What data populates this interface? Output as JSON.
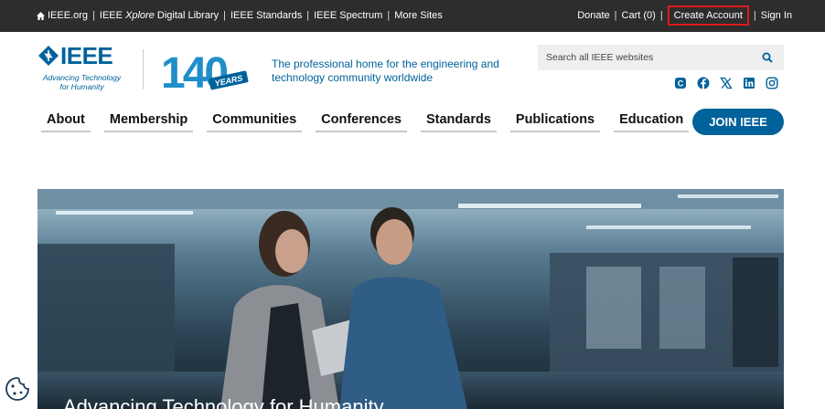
{
  "topbar": {
    "left_links": [
      {
        "label": "IEEE.org"
      },
      {
        "prefix": "IEEE ",
        "italic": "Xplore",
        "suffix": " Digital Library"
      },
      {
        "label": "IEEE Standards"
      },
      {
        "label": "IEEE Spectrum"
      },
      {
        "label": "More Sites"
      }
    ],
    "right_links": {
      "donate": "Donate",
      "cart": "Cart (0)",
      "create_account": "Create Account",
      "sign_in": "Sign In"
    },
    "separator": "|"
  },
  "header": {
    "logo_text": "IEEE",
    "logo_tagline_1": "Advancing Technology",
    "logo_tagline_2": "for Humanity",
    "anniversary_number": "140",
    "anniversary_word": "YEARS",
    "mission": "The professional home for the engineering and technology community worldwide"
  },
  "search": {
    "placeholder": "Search all IEEE websites",
    "value": ""
  },
  "social": [
    "ieee-collabratec-icon",
    "facebook-icon",
    "x-icon",
    "linkedin-icon",
    "instagram-icon"
  ],
  "nav": {
    "items": [
      "About",
      "Membership",
      "Communities",
      "Conferences",
      "Standards",
      "Publications",
      "Education"
    ],
    "join_label": "JOIN IEEE"
  },
  "hero": {
    "title": "Advancing Technology for Humanity"
  },
  "colors": {
    "brand_blue": "#00629b",
    "topbar_bg": "#2d2d2d",
    "highlight_border": "#e01a1a"
  }
}
